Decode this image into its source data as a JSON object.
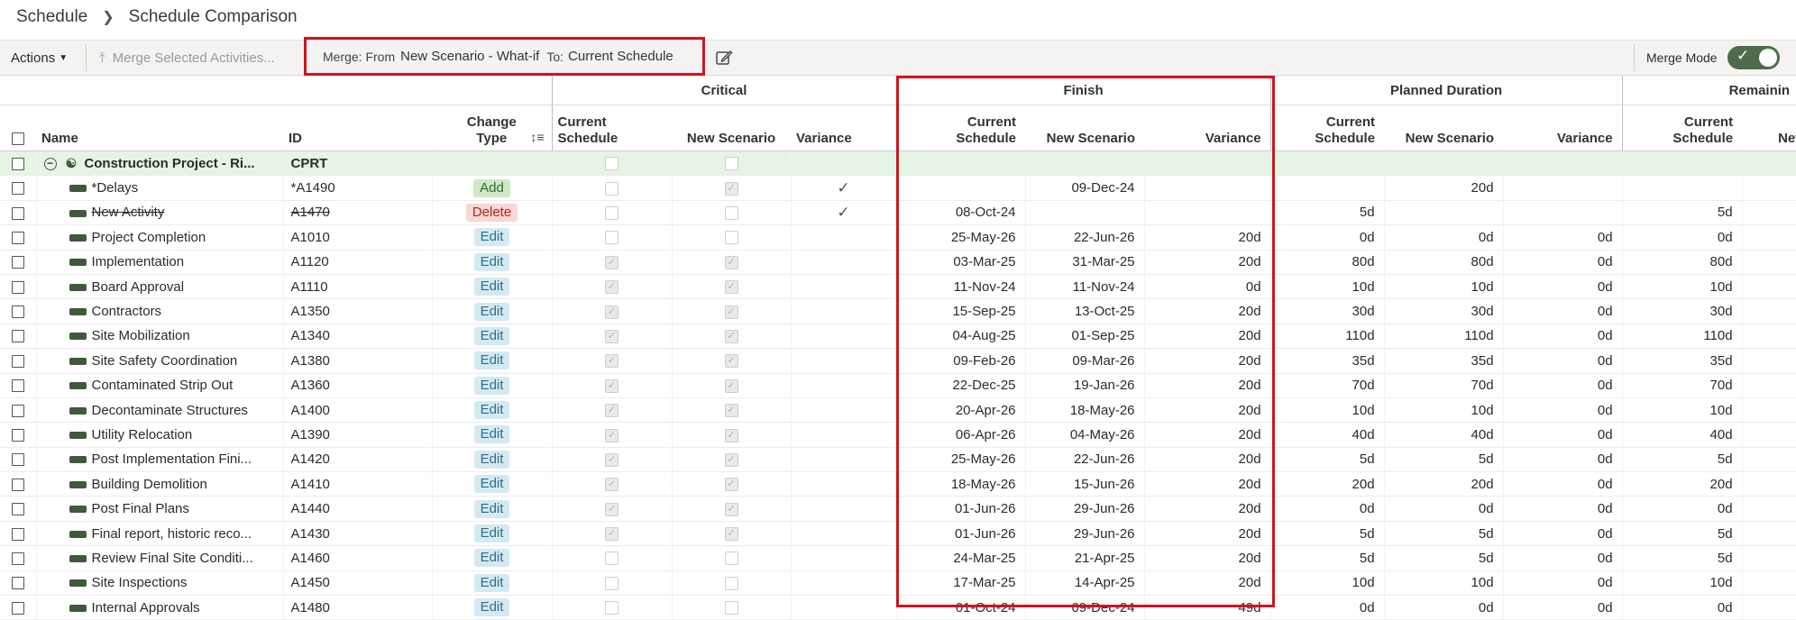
{
  "breadcrumb": {
    "parent": "Schedule",
    "current": "Schedule Comparison"
  },
  "toolbar": {
    "actions_label": "Actions",
    "merge_selected_label": "Merge Selected Activities...",
    "merge_from_label": "Merge: From",
    "merge_from_value": "New Scenario - What-if",
    "merge_to_label": "To:",
    "merge_to_value": "Current Schedule",
    "merge_mode_label": "Merge Mode",
    "merge_mode_on": true
  },
  "columns": {
    "groups": {
      "critical": "Critical",
      "finish": "Finish",
      "planned": "Planned Duration",
      "remaining": "Remainin"
    },
    "name": "Name",
    "id": "ID",
    "change_type_1": "Change",
    "change_type_2": "Type",
    "current_1": "Current",
    "current_2": "Schedule",
    "new_scenario": "New Scenario",
    "new_trunc": "New",
    "variance": "Variance"
  },
  "project": {
    "name": "Construction Project - Ri...",
    "id": "CPRT"
  },
  "rows": [
    {
      "name": "*Delays",
      "id": "*A1490",
      "change": "Add",
      "ccur": false,
      "cnew": true,
      "cvar": "✓",
      "fcur": "",
      "fnew": "09-Dec-24",
      "fvar": "",
      "pcur": "",
      "pnew": "20d",
      "pvar": "",
      "rcur": "",
      "strike": false
    },
    {
      "name": "New Activity",
      "id": "A1470",
      "change": "Delete",
      "ccur": false,
      "cnew": false,
      "cvar": "✓",
      "fcur": "08-Oct-24",
      "fnew": "",
      "fvar": "",
      "pcur": "5d",
      "pnew": "",
      "pvar": "",
      "rcur": "5d",
      "strike": true
    },
    {
      "name": "Project Completion",
      "id": "A1010",
      "change": "Edit",
      "ccur": false,
      "cnew": false,
      "cvar": "",
      "fcur": "25-May-26",
      "fnew": "22-Jun-26",
      "fvar": "20d",
      "pcur": "0d",
      "pnew": "0d",
      "pvar": "0d",
      "rcur": "0d",
      "strike": false
    },
    {
      "name": "Implementation",
      "id": "A1120",
      "change": "Edit",
      "ccur": true,
      "cnew": true,
      "cvar": "",
      "fcur": "03-Mar-25",
      "fnew": "31-Mar-25",
      "fvar": "20d",
      "pcur": "80d",
      "pnew": "80d",
      "pvar": "0d",
      "rcur": "80d",
      "strike": false
    },
    {
      "name": "Board Approval",
      "id": "A1110",
      "change": "Edit",
      "ccur": true,
      "cnew": true,
      "cvar": "",
      "fcur": "11-Nov-24",
      "fnew": "11-Nov-24",
      "fvar": "0d",
      "pcur": "10d",
      "pnew": "10d",
      "pvar": "0d",
      "rcur": "10d",
      "strike": false
    },
    {
      "name": "Contractors",
      "id": "A1350",
      "change": "Edit",
      "ccur": true,
      "cnew": true,
      "cvar": "",
      "fcur": "15-Sep-25",
      "fnew": "13-Oct-25",
      "fvar": "20d",
      "pcur": "30d",
      "pnew": "30d",
      "pvar": "0d",
      "rcur": "30d",
      "strike": false
    },
    {
      "name": "Site Mobilization",
      "id": "A1340",
      "change": "Edit",
      "ccur": true,
      "cnew": true,
      "cvar": "",
      "fcur": "04-Aug-25",
      "fnew": "01-Sep-25",
      "fvar": "20d",
      "pcur": "110d",
      "pnew": "110d",
      "pvar": "0d",
      "rcur": "110d",
      "strike": false
    },
    {
      "name": "Site Safety Coordination",
      "id": "A1380",
      "change": "Edit",
      "ccur": true,
      "cnew": true,
      "cvar": "",
      "fcur": "09-Feb-26",
      "fnew": "09-Mar-26",
      "fvar": "20d",
      "pcur": "35d",
      "pnew": "35d",
      "pvar": "0d",
      "rcur": "35d",
      "strike": false
    },
    {
      "name": "Contaminated Strip Out",
      "id": "A1360",
      "change": "Edit",
      "ccur": true,
      "cnew": true,
      "cvar": "",
      "fcur": "22-Dec-25",
      "fnew": "19-Jan-26",
      "fvar": "20d",
      "pcur": "70d",
      "pnew": "70d",
      "pvar": "0d",
      "rcur": "70d",
      "strike": false
    },
    {
      "name": "Decontaminate Structures",
      "id": "A1400",
      "change": "Edit",
      "ccur": true,
      "cnew": true,
      "cvar": "",
      "fcur": "20-Apr-26",
      "fnew": "18-May-26",
      "fvar": "20d",
      "pcur": "10d",
      "pnew": "10d",
      "pvar": "0d",
      "rcur": "10d",
      "strike": false
    },
    {
      "name": "Utility Relocation",
      "id": "A1390",
      "change": "Edit",
      "ccur": true,
      "cnew": true,
      "cvar": "",
      "fcur": "06-Apr-26",
      "fnew": "04-May-26",
      "fvar": "20d",
      "pcur": "40d",
      "pnew": "40d",
      "pvar": "0d",
      "rcur": "40d",
      "strike": false
    },
    {
      "name": "Post Implementation Fini...",
      "id": "A1420",
      "change": "Edit",
      "ccur": true,
      "cnew": true,
      "cvar": "",
      "fcur": "25-May-26",
      "fnew": "22-Jun-26",
      "fvar": "20d",
      "pcur": "5d",
      "pnew": "5d",
      "pvar": "0d",
      "rcur": "5d",
      "strike": false
    },
    {
      "name": "Building Demolition",
      "id": "A1410",
      "change": "Edit",
      "ccur": true,
      "cnew": true,
      "cvar": "",
      "fcur": "18-May-26",
      "fnew": "15-Jun-26",
      "fvar": "20d",
      "pcur": "20d",
      "pnew": "20d",
      "pvar": "0d",
      "rcur": "20d",
      "strike": false
    },
    {
      "name": "Post Final Plans",
      "id": "A1440",
      "change": "Edit",
      "ccur": true,
      "cnew": true,
      "cvar": "",
      "fcur": "01-Jun-26",
      "fnew": "29-Jun-26",
      "fvar": "20d",
      "pcur": "0d",
      "pnew": "0d",
      "pvar": "0d",
      "rcur": "0d",
      "strike": false
    },
    {
      "name": "Final report, historic reco...",
      "id": "A1430",
      "change": "Edit",
      "ccur": true,
      "cnew": true,
      "cvar": "",
      "fcur": "01-Jun-26",
      "fnew": "29-Jun-26",
      "fvar": "20d",
      "pcur": "5d",
      "pnew": "5d",
      "pvar": "0d",
      "rcur": "5d",
      "strike": false
    },
    {
      "name": "Review Final Site Conditi...",
      "id": "A1460",
      "change": "Edit",
      "ccur": false,
      "cnew": false,
      "cvar": "",
      "fcur": "24-Mar-25",
      "fnew": "21-Apr-25",
      "fvar": "20d",
      "pcur": "5d",
      "pnew": "5d",
      "pvar": "0d",
      "rcur": "5d",
      "strike": false
    },
    {
      "name": "Site Inspections",
      "id": "A1450",
      "change": "Edit",
      "ccur": false,
      "cnew": false,
      "cvar": "",
      "fcur": "17-Mar-25",
      "fnew": "14-Apr-25",
      "fvar": "20d",
      "pcur": "10d",
      "pnew": "10d",
      "pvar": "0d",
      "rcur": "10d",
      "strike": false
    },
    {
      "name": "Internal Approvals",
      "id": "A1480",
      "change": "Edit",
      "ccur": false,
      "cnew": false,
      "cvar": "",
      "fcur": "01-Oct-24",
      "fnew": "09-Dec-24",
      "fvar": "49d",
      "pcur": "0d",
      "pnew": "0d",
      "pvar": "0d",
      "rcur": "0d",
      "strike": false
    }
  ]
}
